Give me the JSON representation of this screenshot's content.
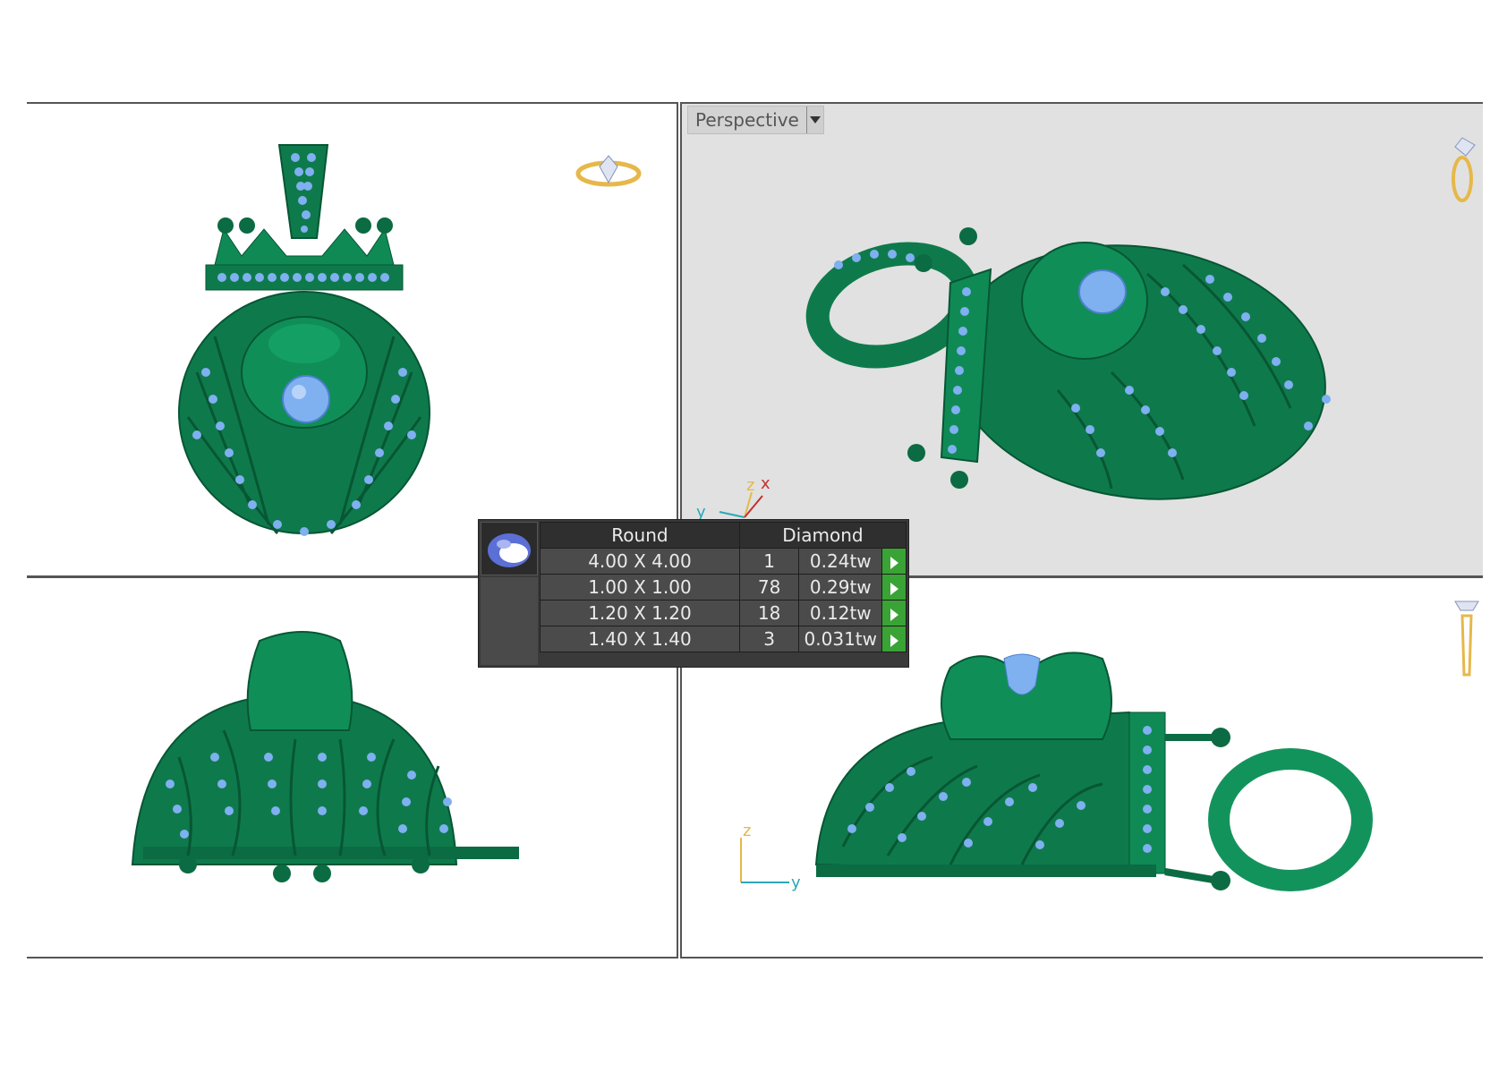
{
  "viewports": {
    "perspective": {
      "label": "Perspective",
      "axes": {
        "x": "x",
        "y": "y",
        "z": "z"
      }
    },
    "right_view": {
      "axes": {
        "z": "z",
        "y": "y"
      }
    }
  },
  "gem_table": {
    "headers": {
      "shape": "Round",
      "material": "Diamond"
    },
    "rows": [
      {
        "size": "4.00 X 4.00",
        "count": "1",
        "weight": "0.24tw"
      },
      {
        "size": "1.00 X 1.00",
        "count": "78",
        "weight": "0.29tw"
      },
      {
        "size": "1.20 X 1.20",
        "count": "18",
        "weight": "0.12tw"
      },
      {
        "size": "1.40 X 1.40",
        "count": "3",
        "weight": "0.031tw"
      }
    ]
  },
  "colors": {
    "metal": "#0e7a4c",
    "metal_light": "#1fa36a",
    "metal_dark": "#075634",
    "gem": "#7fb0f0",
    "gem_dark": "#4d7fd0",
    "viewport_gray": "#e1e1e1",
    "play_button": "#3aa335"
  }
}
